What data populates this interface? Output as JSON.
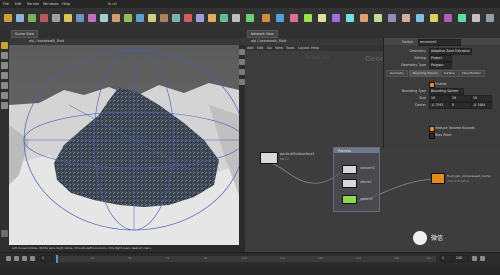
{
  "menubar": {
    "items": [
      "File",
      "Edit",
      "Render",
      "Windows",
      "Help"
    ],
    "build_label": "Build"
  },
  "viewport_tab": "Scene View",
  "viewport_pane_title": "Geometry View",
  "viewport_path": "obj  /  boardwalk_fluid",
  "status_bar": "Left mouse tumbles. Middle pans. Right dollies. Ctrl+Alt+Left box-zooms. Ctrl+Right opens viewport menu.",
  "network": {
    "tab": "Network View",
    "path": "obj  /  boardwalk_fluid",
    "menu": [
      "Add",
      "Edit",
      "Go",
      "View",
      "Tools",
      "Layout",
      "Help"
    ],
    "watermark": "Geometry",
    "context_label": "Houdini Sim",
    "nodes": {
      "input_name": "particlefluidsurface1",
      "input_sub": "no Cl",
      "subnet_title": "Process",
      "subnet_n1": "convert1",
      "subnet_n2": "xform1",
      "subnet_n3": "switch1",
      "output_name": "fluid_sim_compressed_cache",
      "output_sub": "250 of 4ryaf.sc"
    }
  },
  "params": {
    "node_type_label": "Switch",
    "node_name": "recursive1",
    "rows": [
      {
        "label": "Geometry",
        "value": "Adaptive Zone Extractor"
      },
      {
        "label": "Setting",
        "value": "Project"
      },
      {
        "label": "Geometry Type",
        "value": "Polygon"
      }
    ],
    "tabs": [
      "Geometry",
      "Bounding Volume",
      "Surface",
      "Simplification"
    ],
    "enable_label": "Enable",
    "bounding_type_label": "Bounding Type",
    "bounding_type_value": "Bounding Sphere",
    "size_label": "Size",
    "size_values": [
      "19",
      "19",
      "19"
    ],
    "center_label": "Center",
    "center_values": [
      "-0.7593",
      "0",
      "-0.7484"
    ],
    "checkbox_label": "Reduce Volume Bounds",
    "checkbox2_label": "Bias Point"
  },
  "timeline": {
    "frame": "1",
    "end_frame": "240",
    "start_frame": "1",
    "ticks": [
      "1",
      "24",
      "48",
      "72",
      "96",
      "120",
      "144",
      "168",
      "192",
      "216",
      "240"
    ]
  },
  "watermark_text": "微信",
  "colors": {
    "accent": "#e58b1e",
    "viewport_sky": "#5f5f5f",
    "node_input": "#d8d8d8",
    "node_switch": "#8edb4f",
    "node_output": "#e58b1e"
  }
}
